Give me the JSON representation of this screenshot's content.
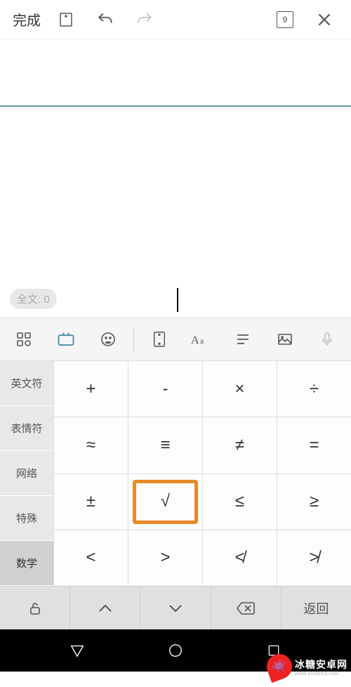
{
  "toolbar": {
    "done": "完成",
    "page_num": "9"
  },
  "editor": {
    "word_count_label": "全文: 0"
  },
  "categories": [
    {
      "label": "英文符"
    },
    {
      "label": "表情符"
    },
    {
      "label": "网络"
    },
    {
      "label": "特殊"
    },
    {
      "label": "数学",
      "active": true
    }
  ],
  "symbols": [
    [
      "+",
      "-",
      "×",
      "÷"
    ],
    [
      "≈",
      "≡",
      "≠",
      "="
    ],
    [
      "±",
      "√",
      "≤",
      "≥"
    ],
    [
      "<",
      ">",
      "≮",
      "≯"
    ]
  ],
  "highlighted": {
    "row": 2,
    "col": 1
  },
  "bottom_fn": {
    "return": "返回"
  },
  "watermark": {
    "main": "冰糖安卓网",
    "sub": "www.btxtdmy.com"
  }
}
